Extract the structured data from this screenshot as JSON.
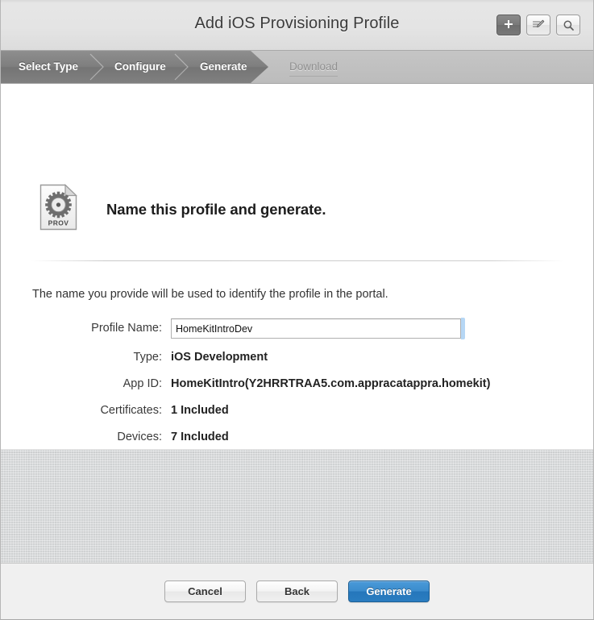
{
  "window": {
    "title": "Add iOS Provisioning Profile"
  },
  "toolbar": {
    "buttons": [
      {
        "name": "add-button",
        "icon": "plus-icon",
        "active": true
      },
      {
        "name": "edit-button",
        "icon": "compose-icon",
        "active": false
      },
      {
        "name": "search-button",
        "icon": "search-icon",
        "active": false
      }
    ]
  },
  "steps": [
    {
      "label": "Select Type",
      "state": "done"
    },
    {
      "label": "Configure",
      "state": "done"
    },
    {
      "label": "Generate",
      "state": "current"
    },
    {
      "label": "Download",
      "state": "pending"
    }
  ],
  "main": {
    "icon_label": "PROV",
    "icon_name": "provisioning-profile-icon",
    "heading": "Name this profile and generate.",
    "lead_text": "The name you provide will be used to identify the profile in the portal.",
    "fields": [
      {
        "label": "Profile Name:",
        "type": "input",
        "value": "HomeKitIntroDev",
        "placeholder": "",
        "focused": true
      },
      {
        "label": "Type:",
        "type": "text",
        "value": "iOS Development"
      },
      {
        "label": "App ID:",
        "type": "text",
        "value": "HomeKitIntro(Y2HRRTRAA5.com.appracatappra.homekit)"
      },
      {
        "label": "Certificates:",
        "type": "text",
        "value": "1 Included"
      },
      {
        "label": "Devices:",
        "type": "text",
        "value": "7 Included"
      }
    ]
  },
  "footer": {
    "cancel_label": "Cancel",
    "back_label": "Back",
    "generate_label": "Generate"
  },
  "colors": {
    "primary_button": "#2a7dc0",
    "focus_ring": "#b6d7f5",
    "step_done_bg": "#7e7e7e",
    "linen_bg": "#d7d9da"
  }
}
